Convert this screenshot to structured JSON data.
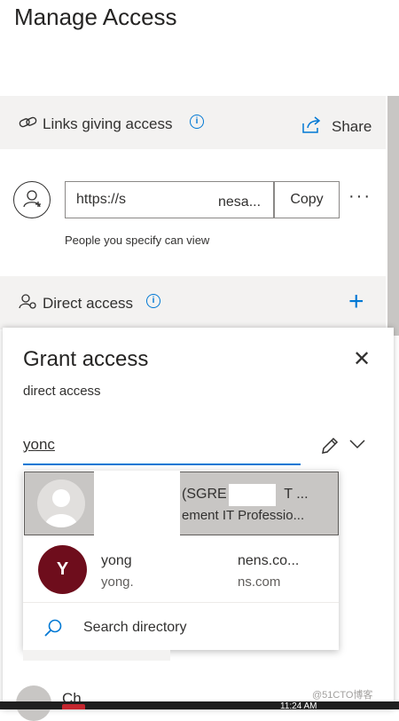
{
  "header": {
    "title": "Manage Access"
  },
  "links_section": {
    "label": "Links giving access",
    "info_glyph": "i",
    "share_label": "Share",
    "link_url_start": "https://s",
    "link_url_end": "nesa...",
    "copy_label": "Copy",
    "more_label": "···",
    "caption": "People you specify can view"
  },
  "direct_section": {
    "label": "Direct access",
    "add_glyph": "+"
  },
  "grant_panel": {
    "title": "Grant access",
    "subtitle": "direct access",
    "close_glyph": "✕",
    "search_value": "yonc",
    "suggestions": [
      {
        "name_visible": "(SGRE",
        "name_tail": "T ...",
        "role_visible": "ement IT Professio..."
      },
      {
        "initial": "Y",
        "name_start": "yong",
        "name_end": "nens.co...",
        "email_start": "yong.",
        "email_end": "ns.com"
      }
    ],
    "search_directory_label": "Search directory"
  },
  "bottom": {
    "text": "Ch",
    "time": "11:24 AM"
  },
  "watermark": "@51CTO博客",
  "colors": {
    "accent": "#0078d4",
    "avatar_y": "#6e0d1c",
    "band": "#f3f2f1"
  }
}
